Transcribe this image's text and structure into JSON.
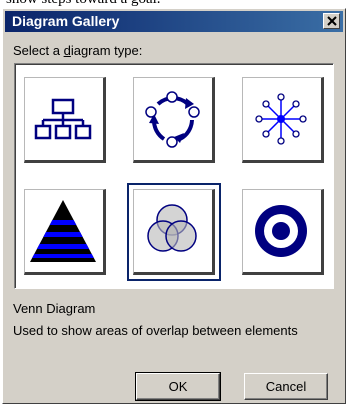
{
  "top_fragment": "show steps toward a goal.",
  "dialog": {
    "title": "Diagram Gallery",
    "prompt_prefix": "Select a ",
    "prompt_hotkey": "d",
    "prompt_suffix": "iagram type:"
  },
  "diagrams": [
    {
      "type": "Organization Chart",
      "icon": "org-chart-icon"
    },
    {
      "type": "Cycle Diagram",
      "icon": "cycle-icon"
    },
    {
      "type": "Radial Diagram",
      "icon": "radial-icon"
    },
    {
      "type": "Pyramid Diagram",
      "icon": "pyramid-icon"
    },
    {
      "type": "Venn Diagram",
      "icon": "venn-icon",
      "selected": true
    },
    {
      "type": "Target Diagram",
      "icon": "target-icon"
    }
  ],
  "selected": {
    "name": "Venn Diagram",
    "description": "Used to show areas of overlap between elements"
  },
  "buttons": {
    "ok": "OK",
    "cancel": "Cancel"
  },
  "colors": {
    "title_bar_start": "#0a246a",
    "title_bar_end": "#3a6ea5",
    "dialog_face": "#d4d0c8",
    "icon_navy": "#000080",
    "icon_blue": "#0000ff"
  }
}
